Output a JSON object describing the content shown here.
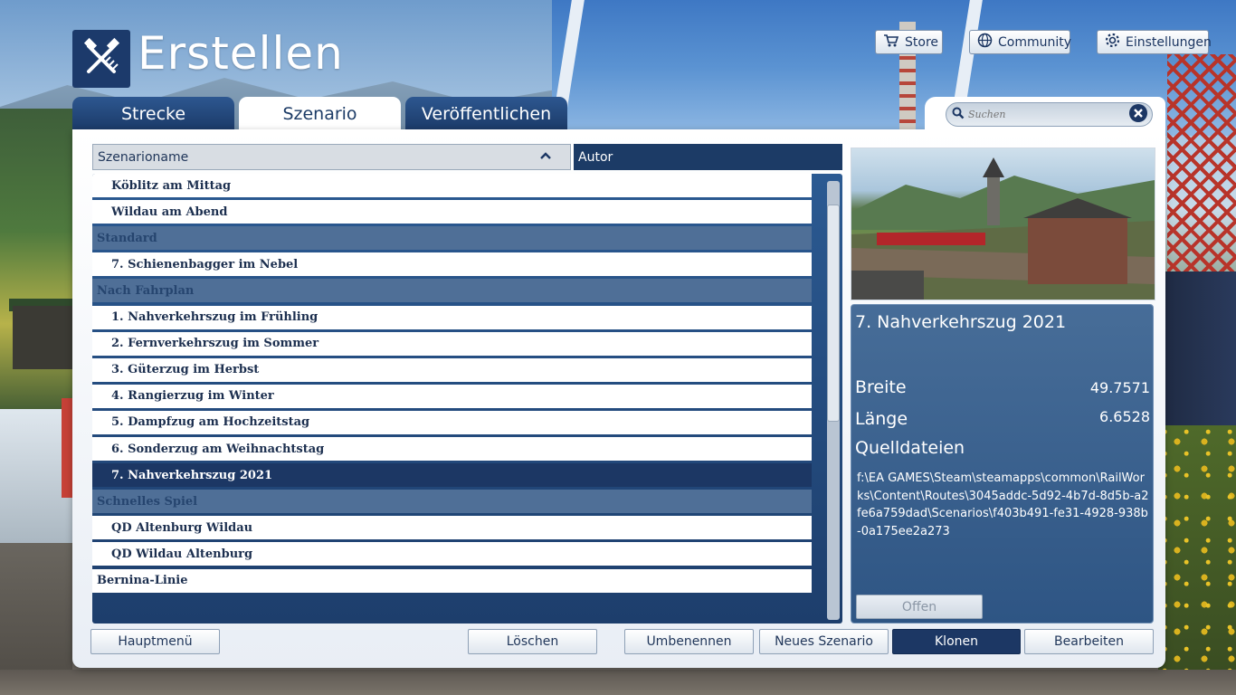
{
  "header": {
    "title": "Erstellen",
    "logo_icon": "rail-tools-icon"
  },
  "top_buttons": {
    "store": "Store",
    "community": "Community",
    "settings": "Einstellungen"
  },
  "tabs": [
    {
      "label": "Strecke",
      "active": false
    },
    {
      "label": "Szenario",
      "active": true
    },
    {
      "label": "Veröffentlichen",
      "active": false
    }
  ],
  "search": {
    "placeholder": "Suchen",
    "value": ""
  },
  "list": {
    "columns": {
      "name": "Szenarioname",
      "author": "Autor",
      "sort": "ascending"
    },
    "rows": [
      {
        "type": "item",
        "label": "Köblitz am Mittag"
      },
      {
        "type": "item",
        "label": "Wildau am Abend"
      },
      {
        "type": "group",
        "label": "Standard"
      },
      {
        "type": "item",
        "label": "7. Schienenbagger im Nebel"
      },
      {
        "type": "group",
        "label": "Nach Fahrplan"
      },
      {
        "type": "item",
        "label": "1. Nahverkehrszug im Frühling"
      },
      {
        "type": "item",
        "label": "2. Fernverkehrszug im Sommer"
      },
      {
        "type": "item",
        "label": "3. Güterzug im Herbst"
      },
      {
        "type": "item",
        "label": "4. Rangierzug im Winter"
      },
      {
        "type": "item",
        "label": "5. Dampfzug am Hochzeitstag"
      },
      {
        "type": "item",
        "label": "6. Sonderzug am Weihnachtstag"
      },
      {
        "type": "item",
        "label": "7. Nahverkehrszug 2021",
        "selected": true
      },
      {
        "type": "group",
        "label": "Schnelles Spiel"
      },
      {
        "type": "item",
        "label": "QD Altenburg Wildau"
      },
      {
        "type": "item",
        "label": "QD Wildau Altenburg"
      },
      {
        "type": "item",
        "label": "Bernina-Linie",
        "top_level": true
      }
    ]
  },
  "details": {
    "title": "7. Nahverkehrszug 2021",
    "latitude_label": "Breite",
    "latitude_value": "49.7571",
    "longitude_label": "Länge",
    "longitude_value": "6.6528",
    "source_label": "Quelldateien",
    "source_path": "f:\\EA GAMES\\Steam\\steamapps\\common\\RailWorks\\Content\\Routes\\3045addc-5d92-4b7d-8d5b-a2fe6a759dad\\Scenarios\\f403b491-fe31-4928-938b-0a175ee2a273",
    "open_button": "Offen"
  },
  "bottom_buttons": {
    "main_menu": "Hauptmenü",
    "delete": "Löschen",
    "rename": "Umbenennen",
    "new_scenario": "Neues Szenario",
    "clone": "Klonen",
    "edit": "Bearbeiten"
  },
  "colors": {
    "accent_dark": "#1c3764",
    "tab_blue": "#1b3a68",
    "group_row": "#4f6f97"
  }
}
